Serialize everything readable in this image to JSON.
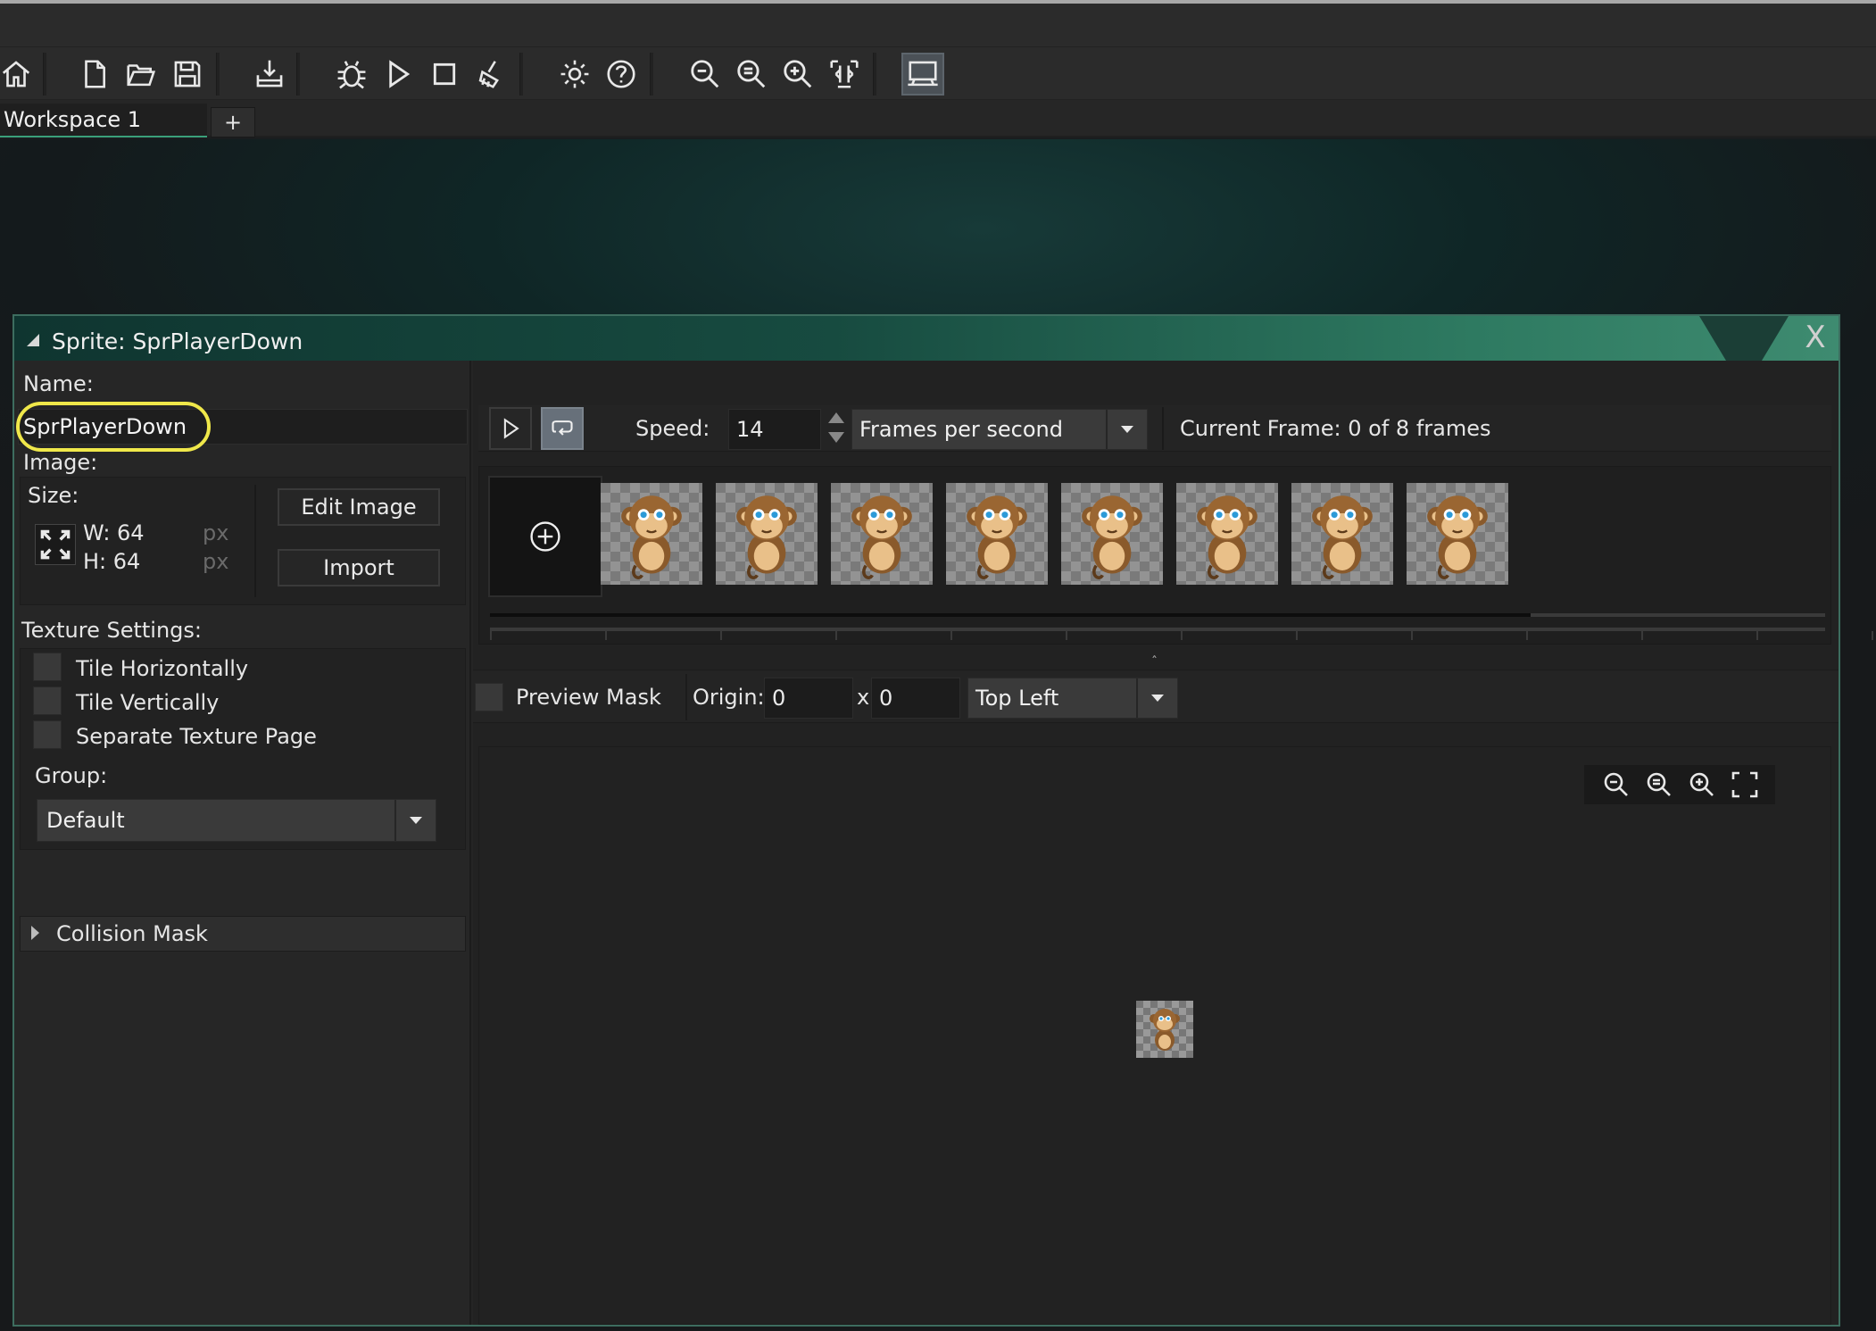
{
  "toolbar": {
    "icons": [
      "home-icon",
      "new-file-icon",
      "open-folder-icon",
      "save-icon",
      "export-icon",
      "debug-icon",
      "run-icon",
      "stop-icon",
      "clean-icon",
      "settings-icon",
      "help-icon",
      "zoom-out-icon",
      "zoom-reset-icon",
      "zoom-in-icon",
      "fit-icon",
      "device-icon"
    ]
  },
  "tabs": {
    "workspace": "Workspace 1",
    "add": "+"
  },
  "window": {
    "title": "Sprite: SprPlayerDown",
    "close": "X"
  },
  "left": {
    "name_label": "Name:",
    "name_value": "SprPlayerDown",
    "image_label": "Image:",
    "size_label": "Size:",
    "width": "W: 64",
    "height": "H: 64",
    "unit": "px",
    "edit_image": "Edit Image",
    "import": "Import",
    "texture_label": "Texture Settings:",
    "tile_h": "Tile Horizontally",
    "tile_v": "Tile Vertically",
    "sep_page": "Separate Texture Page",
    "group_label": "Group:",
    "group_value": "Default",
    "collision": "Collision Mask"
  },
  "controls": {
    "speed_label": "Speed:",
    "speed_value": "14",
    "speed_unit": "Frames per second",
    "current_frame": "Current Frame: 0 of 8 frames"
  },
  "frames": {
    "count": 8,
    "current": 0
  },
  "origin": {
    "preview_mask": "Preview Mask",
    "origin_label": "Origin:",
    "x": "0",
    "sep": "x",
    "y": "0",
    "preset": "Top Left"
  },
  "colors": {
    "accent": "#3aa07a",
    "highlight": "#f0e84a"
  }
}
